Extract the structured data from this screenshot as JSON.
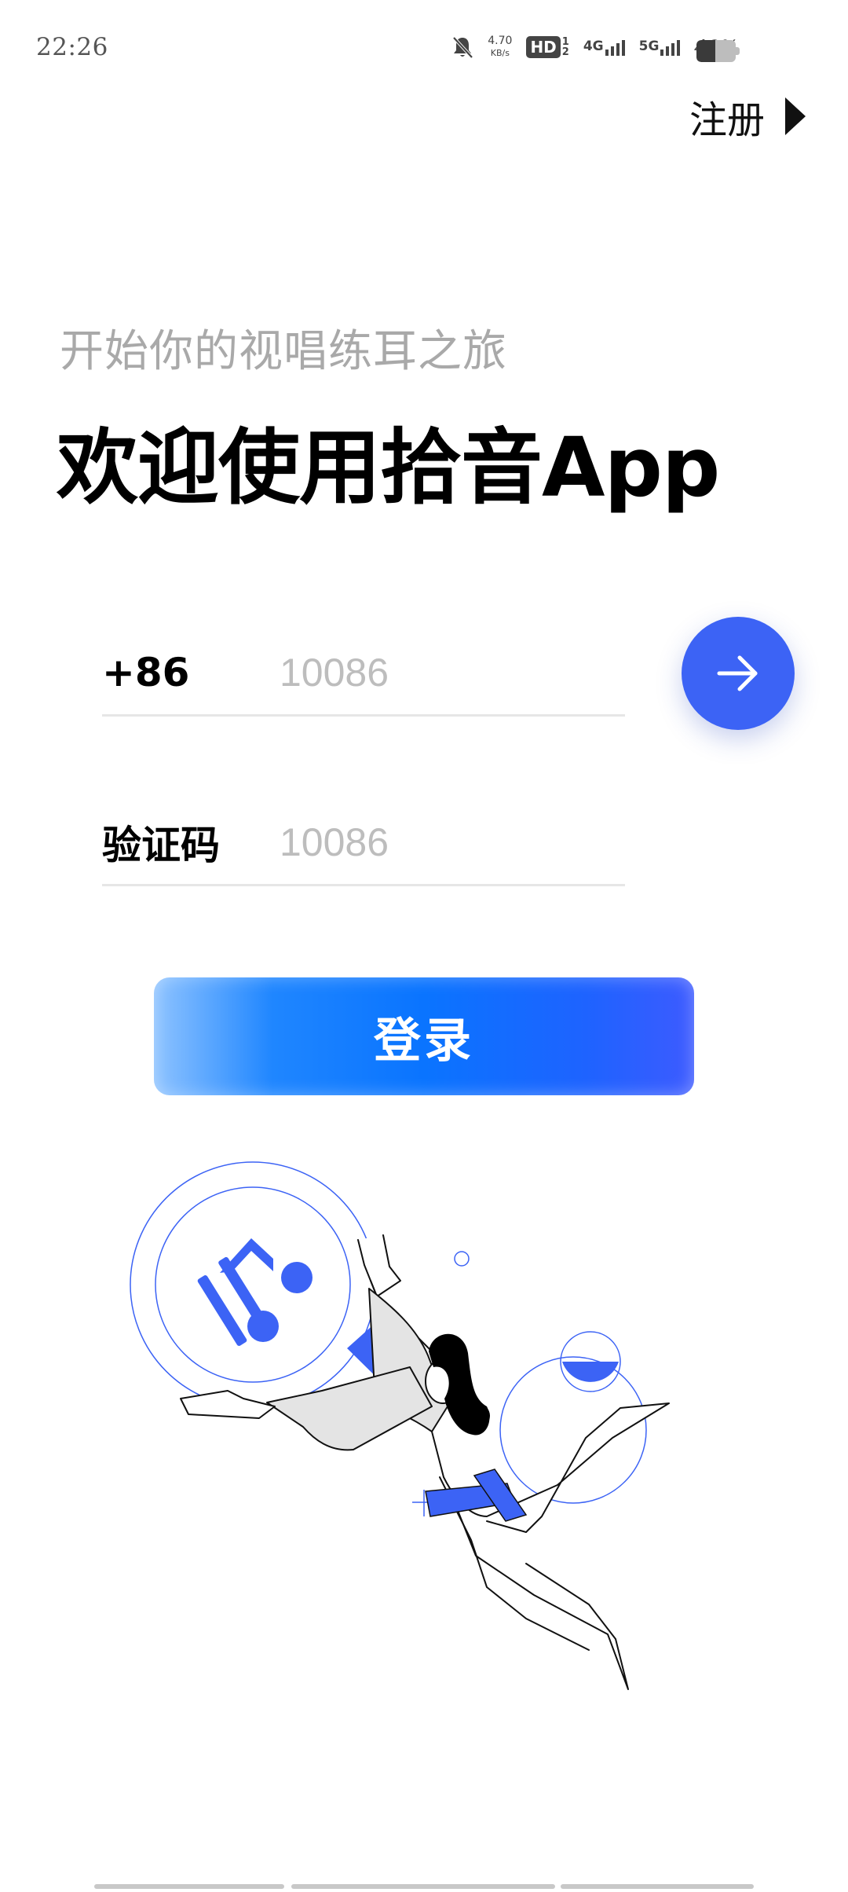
{
  "status_bar": {
    "time": "22:26",
    "network_speed_value": "4.70",
    "network_speed_unit": "KB/s",
    "hd_label": "HD",
    "hd_sims": [
      "1",
      "2"
    ],
    "signal_1_label": "4G",
    "signal_2_label": "5G",
    "battery_percent_label": "48%",
    "battery_level": 0.48,
    "icons": [
      "mute-bell-icon",
      "hd-voice-icon",
      "signal-4g-icon",
      "signal-5g-icon",
      "battery-icon"
    ]
  },
  "header": {
    "register_label": "注册",
    "register_icon": "play-triangle-icon"
  },
  "hero": {
    "subtitle": "开始你的视唱练耳之旅",
    "title": "欢迎使用拾音App"
  },
  "form": {
    "phone": {
      "label": "+86",
      "placeholder": "10086",
      "value": ""
    },
    "code": {
      "label": "验证码",
      "placeholder": "10086",
      "value": ""
    },
    "next_button_icon": "arrow-right-icon"
  },
  "login_button": {
    "label": "登录"
  },
  "colors": {
    "accent": "#3c63f5",
    "login_gradient_start": "#8ec3ff",
    "login_gradient_mid": "#0a74ff",
    "login_gradient_end": "#3d5bff",
    "subtitle": "#a9a9a9",
    "placeholder": "#bdbdbd",
    "divider": "#e6e6e6"
  }
}
